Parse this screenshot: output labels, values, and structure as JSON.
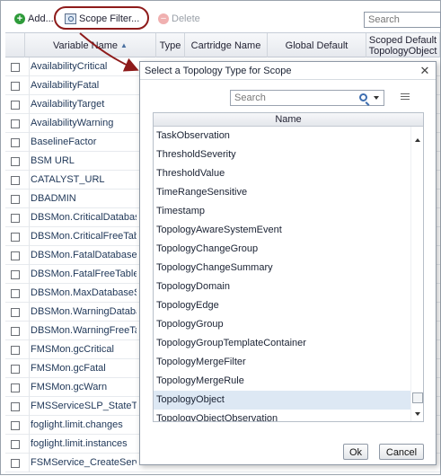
{
  "toolbar": {
    "add_label": "Add...",
    "scope_filter_label": "Scope Filter...",
    "delete_label": "Delete",
    "search_placeholder": "Search"
  },
  "grid": {
    "columns": [
      "Variable Name",
      "Type",
      "Cartridge Name",
      "Global Default",
      "Scoped Default TopologyObject"
    ],
    "sort_indicator": "▲",
    "rows": [
      "AvailabilityCritical",
      "AvailabilityFatal",
      "AvailabilityTarget",
      "AvailabilityWarning",
      "BaselineFactor",
      "BSM URL",
      "CATALYST_URL",
      "DBADMIN",
      "DBSMon.CriticalDatabaseUsage",
      "DBSMon.CriticalFreeTablespace",
      "DBSMon.FatalDatabaseUsage",
      "DBSMon.FatalFreeTablespace",
      "DBSMon.MaxDatabaseSize",
      "DBSMon.WarningDatabaseUsage",
      "DBSMon.WarningFreeTablespace",
      "FMSMon.gcCritical",
      "FMSMon.gcFatal",
      "FMSMon.gcWarn",
      "FMSServiceSLP_StateThreshold",
      "foglight.limit.changes",
      "foglight.limit.instances",
      "FSMService_CreateServiceInstance"
    ]
  },
  "dialog": {
    "title": "Select a Topology Type for Scope",
    "close_glyph": "✕",
    "search_placeholder": "Search",
    "list_header": "Name",
    "items": [
      "TaskObservation",
      "ThresholdSeverity",
      "ThresholdValue",
      "TimeRangeSensitive",
      "Timestamp",
      "TopologyAwareSystemEvent",
      "TopologyChangeGroup",
      "TopologyChangeSummary",
      "TopologyDomain",
      "TopologyEdge",
      "TopologyGroup",
      "TopologyGroupTemplateContainer",
      "TopologyMergeFilter",
      "TopologyMergeRule",
      "TopologyObject",
      "TopologyObjectObservation"
    ],
    "selected_item": "TopologyObject",
    "ok_label": "Ok",
    "cancel_label": "Cancel"
  },
  "colors": {
    "highlight_ring": "#8e1b1b",
    "selected_row": "#dde8f4",
    "add_icon": "#2e9b3a"
  }
}
